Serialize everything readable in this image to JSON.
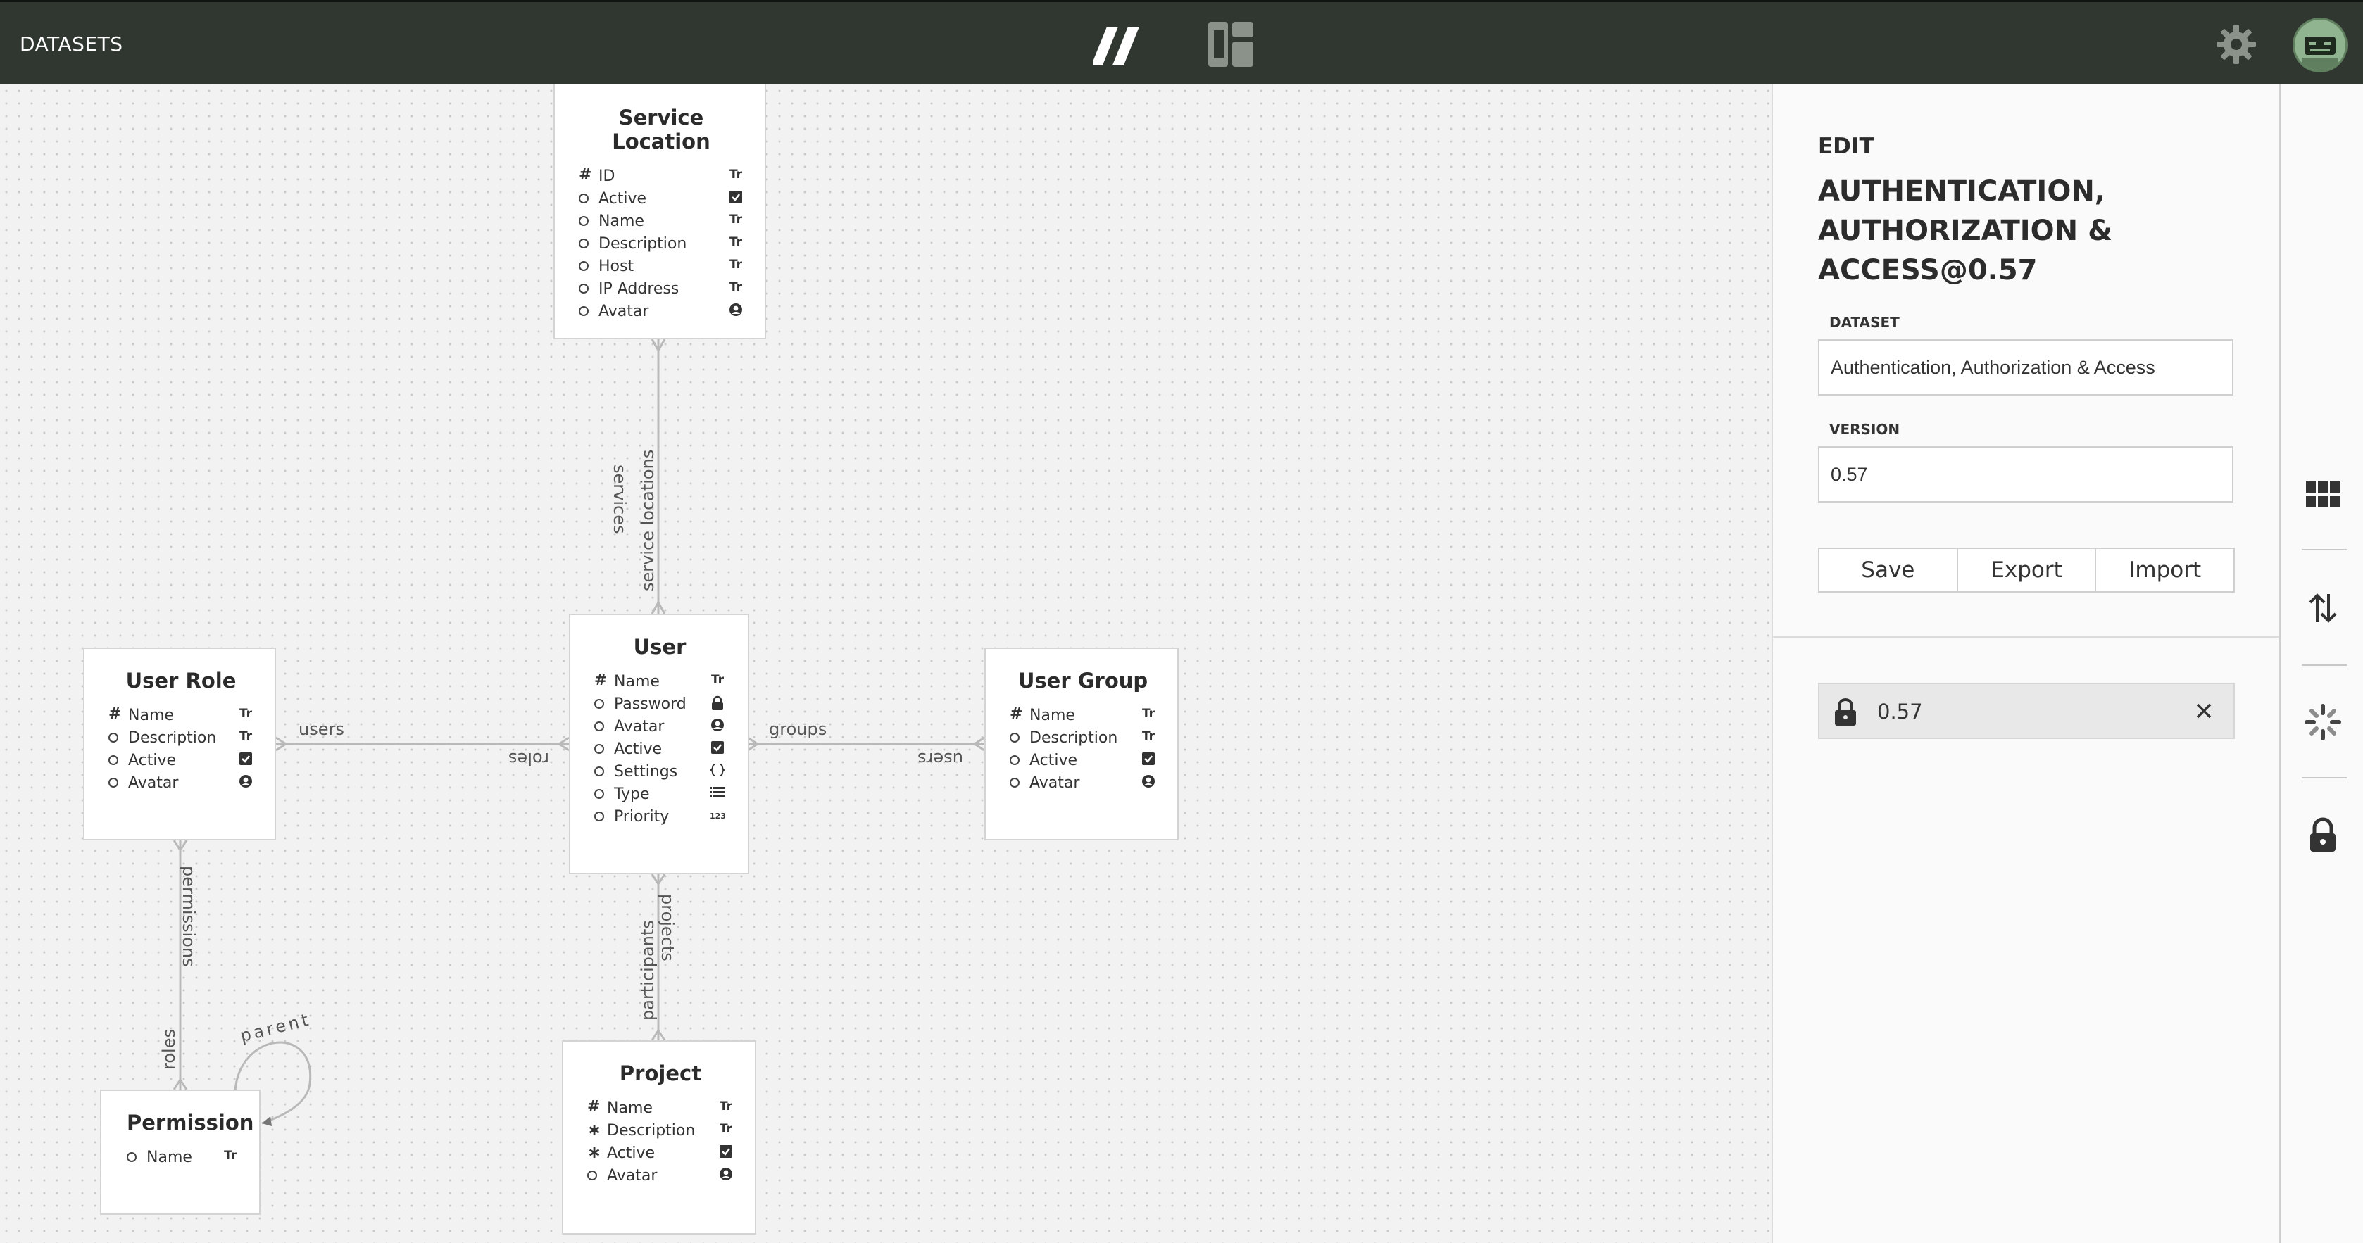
{
  "header": {
    "title": "DATASETS",
    "icons": [
      "logo-icon",
      "layout-icon",
      "gear-icon",
      "avatar"
    ]
  },
  "diagram": {
    "entities": {
      "service_location": {
        "title": "Service Location",
        "fields": [
          {
            "name": "ID",
            "marker": "#",
            "type": "Tr"
          },
          {
            "name": "Active",
            "marker": "o",
            "type": "checkbox"
          },
          {
            "name": "Name",
            "marker": "o",
            "type": "Tr"
          },
          {
            "name": "Description",
            "marker": "o",
            "type": "Tr"
          },
          {
            "name": "Host",
            "marker": "o",
            "type": "Tr"
          },
          {
            "name": "IP Address",
            "marker": "o",
            "type": "Tr"
          },
          {
            "name": "Avatar",
            "marker": "o",
            "type": "avatar"
          }
        ]
      },
      "user": {
        "title": "User",
        "fields": [
          {
            "name": "Name",
            "marker": "#",
            "type": "Tr"
          },
          {
            "name": "Password",
            "marker": "o",
            "type": "lock"
          },
          {
            "name": "Avatar",
            "marker": "o",
            "type": "avatar"
          },
          {
            "name": "Active",
            "marker": "o",
            "type": "checkbox"
          },
          {
            "name": "Settings",
            "marker": "o",
            "type": "braces"
          },
          {
            "name": "Type",
            "marker": "o",
            "type": "list"
          },
          {
            "name": "Priority",
            "marker": "o",
            "type": "number"
          }
        ]
      },
      "user_role": {
        "title": "User Role",
        "fields": [
          {
            "name": "Name",
            "marker": "#",
            "type": "Tr"
          },
          {
            "name": "Description",
            "marker": "o",
            "type": "Tr"
          },
          {
            "name": "Active",
            "marker": "o",
            "type": "checkbox"
          },
          {
            "name": "Avatar",
            "marker": "o",
            "type": "avatar"
          }
        ]
      },
      "user_group": {
        "title": "User Group",
        "fields": [
          {
            "name": "Name",
            "marker": "#",
            "type": "Tr"
          },
          {
            "name": "Description",
            "marker": "o",
            "type": "Tr"
          },
          {
            "name": "Active",
            "marker": "o",
            "type": "checkbox"
          },
          {
            "name": "Avatar",
            "marker": "o",
            "type": "avatar"
          }
        ]
      },
      "permission": {
        "title": "Permission",
        "fields": [
          {
            "name": "Name",
            "marker": "o",
            "type": "Tr"
          }
        ]
      },
      "project": {
        "title": "Project",
        "fields": [
          {
            "name": "Name",
            "marker": "#",
            "type": "Tr"
          },
          {
            "name": "Description",
            "marker": "*",
            "type": "Tr"
          },
          {
            "name": "Active",
            "marker": "*",
            "type": "checkbox"
          },
          {
            "name": "Avatar",
            "marker": "o",
            "type": "avatar"
          }
        ]
      }
    },
    "relations": {
      "services": "services",
      "service_locations": "service locations",
      "users_role": "users",
      "roles": "roles",
      "groups": "groups",
      "users_group": "users",
      "permissions": "permissions",
      "roles_perm": "roles",
      "parent": "parent",
      "projects": "projects",
      "participants": "participants"
    },
    "type_glyphs": {
      "Tr": "Tr",
      "number": "123"
    }
  },
  "panel": {
    "eyebrow": "EDIT",
    "title": "AUTHENTICATION, AUTHORIZATION & ACCESS@0.57",
    "dataset_label": "DATASET",
    "dataset_value": "Authentication, Authorization & Access",
    "version_label": "VERSION",
    "version_value": "0.57",
    "buttons": {
      "save": "Save",
      "export": "Export",
      "import": "Import"
    },
    "version_chip": "0.57"
  },
  "toolbar": {
    "tools": [
      "grid-icon",
      "sort-arrows-icon",
      "loading-spinner-icon",
      "lock-icon"
    ]
  },
  "colors": {
    "topbar": "#303730",
    "canvas": "#f2f2f2",
    "panel": "#fafafa",
    "text": "#2b2b2b"
  }
}
